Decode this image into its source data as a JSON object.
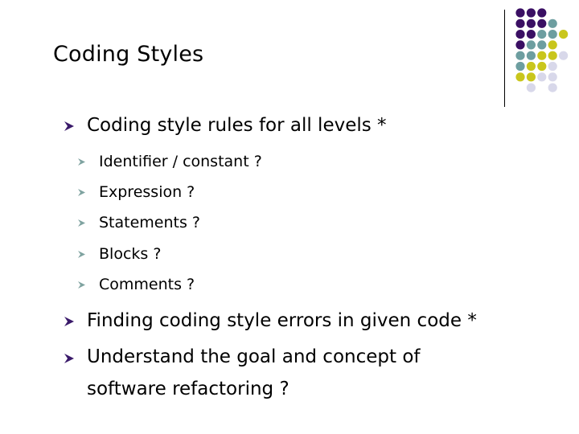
{
  "slide": {
    "title": "Coding Styles",
    "colors": {
      "purple": "#3a0f63",
      "teal": "#6d9ea0",
      "yellow": "#c9c61c",
      "lavender": "#d8d8ea",
      "bullet_level1": "#3a1a6a",
      "bullet_level2": "#7fa3a0"
    },
    "decoration": {
      "dot_grid_rows": [
        [
          "purple",
          "purple",
          "purple",
          null,
          null
        ],
        [
          "purple",
          "purple",
          "purple",
          "teal",
          null
        ],
        [
          "purple",
          "purple",
          "teal",
          "teal",
          "yellow"
        ],
        [
          "purple",
          "teal",
          "teal",
          "yellow",
          null
        ],
        [
          "teal",
          "teal",
          "yellow",
          "yellow",
          "lavender"
        ],
        [
          "teal",
          "yellow",
          "yellow",
          "lavender",
          null
        ],
        [
          "yellow",
          "yellow",
          "lavender",
          "lavender",
          null
        ],
        [
          null,
          "lavender",
          null,
          "lavender",
          null
        ]
      ]
    },
    "bullets": [
      {
        "text": "Coding style rules for all levels *",
        "sub": [
          {
            "text": "Identifier / constant ?"
          },
          {
            "text": "Expression ?"
          },
          {
            "text": "Statements ?"
          },
          {
            "text": "Blocks ?"
          },
          {
            "text": "Comments ?"
          }
        ]
      },
      {
        "text": "Finding coding style errors in given code *"
      },
      {
        "text": "Understand the goal and concept of software refactoring ?"
      }
    ]
  }
}
